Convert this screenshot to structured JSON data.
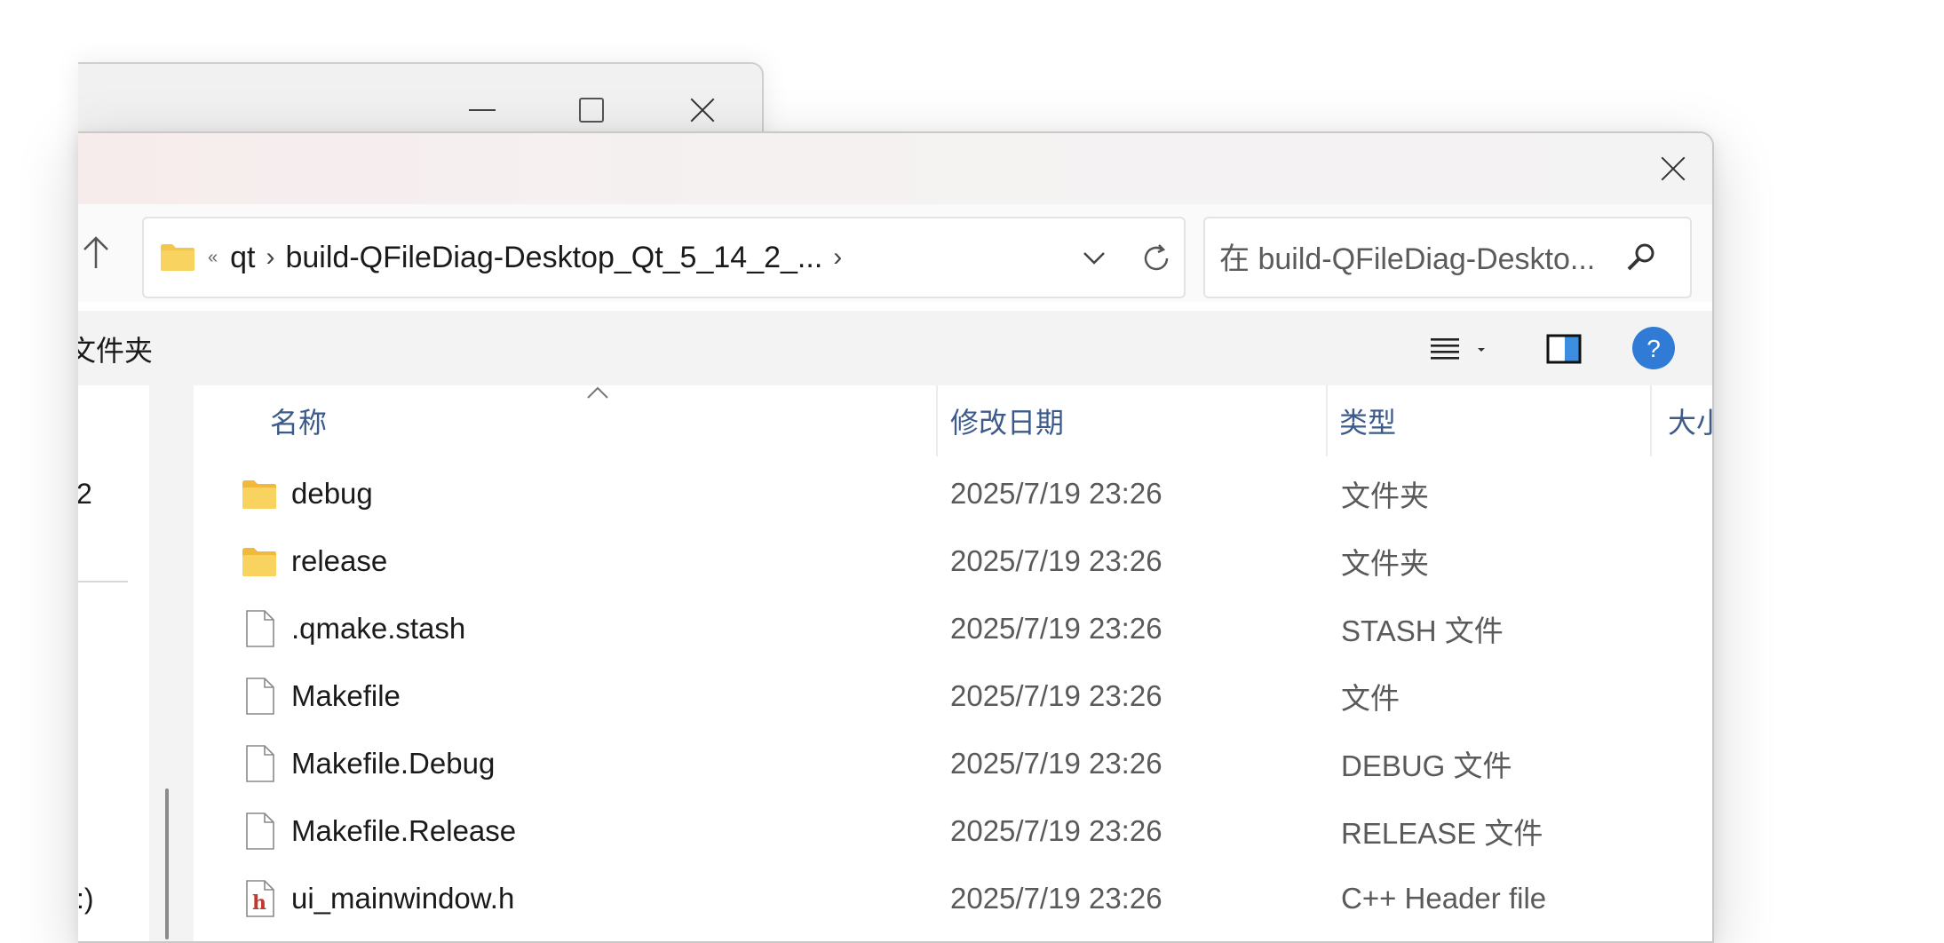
{
  "background_window": {
    "controls": [
      "minimize",
      "maximize",
      "close"
    ]
  },
  "dialog": {
    "close_icon": "close-icon",
    "address_bar": {
      "overflow_indicator": "«",
      "segments": [
        "qt",
        "build-QFileDiag-Desktop_Qt_5_14_2_..."
      ]
    },
    "search": {
      "placeholder": "在 build-QFileDiag-Deskto..."
    },
    "toolbar": {
      "new_folder_label": "文件夹"
    },
    "sidebar": {
      "items": [
        "2",
        ":)"
      ]
    },
    "columns": {
      "name": "名称",
      "date": "修改日期",
      "type": "类型",
      "size": "大小"
    },
    "files": [
      {
        "name": "debug",
        "date": "2025/7/19 23:26",
        "type": "文件夹",
        "icon": "folder-icon"
      },
      {
        "name": "release",
        "date": "2025/7/19 23:26",
        "type": "文件夹",
        "icon": "folder-icon"
      },
      {
        "name": ".qmake.stash",
        "date": "2025/7/19 23:26",
        "type": "STASH 文件",
        "icon": "file-icon"
      },
      {
        "name": "Makefile",
        "date": "2025/7/19 23:26",
        "type": "文件",
        "icon": "file-icon"
      },
      {
        "name": "Makefile.Debug",
        "date": "2025/7/19 23:26",
        "type": "DEBUG 文件",
        "icon": "file-icon"
      },
      {
        "name": "Makefile.Release",
        "date": "2025/7/19 23:26",
        "type": "RELEASE 文件",
        "icon": "file-icon"
      },
      {
        "name": "ui_mainwindow.h",
        "date": "2025/7/19 23:26",
        "type": "C++ Header file",
        "icon": "header-file-icon"
      }
    ],
    "colors": {
      "folder": "#f4c64e",
      "accent_blue": "#2f7bd6",
      "header_text": "#3c5a8a"
    }
  }
}
